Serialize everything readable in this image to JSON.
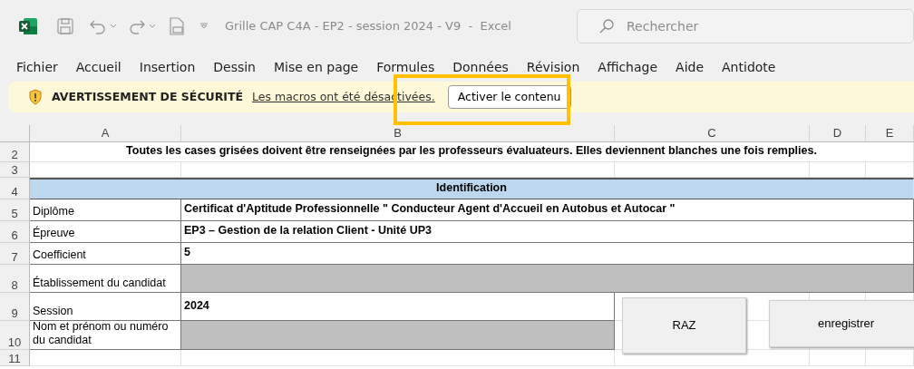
{
  "title_bar": {
    "title": "Grille CAP C4A - EP2 - session 2024 - V9  -  Excel",
    "search": {
      "placeholder": "Rechercher"
    }
  },
  "menu": [
    "Fichier",
    "Accueil",
    "Insertion",
    "Dessin",
    "Mise en page",
    "Formules",
    "Données",
    "Révision",
    "Affichage",
    "Aide",
    "Antidote"
  ],
  "security_bar": {
    "title": "AVERTISSEMENT DE SÉCURITÉ",
    "message": "Les macros ont été désactivées.",
    "button": "Activer le contenu"
  },
  "sheet": {
    "columns": [
      "A",
      "B",
      "C",
      "D",
      "E"
    ],
    "rows": [
      {
        "number": "2",
        "cells": [
          {
            "kind": "note",
            "text": "Toutes les cases grisées doivent être renseignées par les professeurs évaluateurs. Elles deviennent blanches une fois remplies."
          }
        ]
      },
      {
        "number": "3",
        "cells": [
          {
            "kind": "blank"
          },
          {
            "kind": "blank"
          },
          {
            "kind": "blank"
          },
          {
            "kind": "blank"
          },
          {
            "kind": "blank"
          }
        ]
      },
      {
        "number": "4",
        "cells": [
          {
            "kind": "header",
            "text": "Identification"
          }
        ]
      },
      {
        "number": "5",
        "cells": [
          {
            "kind": "label",
            "text": "Diplôme"
          },
          {
            "kind": "value",
            "text": "Certificat d'Aptitude Professionnelle \" Conducteur Agent d'Accueil en Autobus et Autocar \""
          }
        ]
      },
      {
        "number": "6",
        "cells": [
          {
            "kind": "label",
            "text": "Épreuve"
          },
          {
            "kind": "value",
            "text": "EP3 – Gestion de la relation Client - Unité UP3"
          }
        ]
      },
      {
        "number": "7",
        "cells": [
          {
            "kind": "label",
            "text": "Coefficient"
          },
          {
            "kind": "value",
            "text": "5"
          }
        ]
      },
      {
        "number": "8",
        "cells": [
          {
            "kind": "label",
            "text": "Établissement du candidat"
          },
          {
            "kind": "input"
          }
        ]
      },
      {
        "number": "9",
        "cells": [
          {
            "kind": "label",
            "text": "Session"
          },
          {
            "kind": "value",
            "text": "2024"
          },
          {
            "kind": "blank"
          },
          {
            "kind": "blank"
          },
          {
            "kind": "blank"
          }
        ]
      },
      {
        "number": "10",
        "cells": [
          {
            "kind": "label",
            "text": "Nom et prénom ou numéro du candidat"
          },
          {
            "kind": "input"
          },
          {
            "kind": "blank"
          },
          {
            "kind": "blank"
          },
          {
            "kind": "blank"
          }
        ]
      },
      {
        "number": "11",
        "cells": [
          {
            "kind": "blank"
          },
          {
            "kind": "blank"
          },
          {
            "kind": "blank"
          },
          {
            "kind": "blank"
          },
          {
            "kind": "blank"
          }
        ]
      }
    ]
  },
  "buttons": [
    "RAZ",
    "enregistrer"
  ]
}
